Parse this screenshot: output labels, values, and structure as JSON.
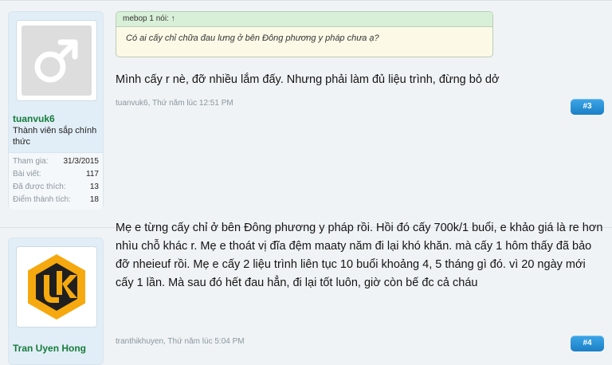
{
  "post3": {
    "user": {
      "name": "tuanvuk6",
      "title": "Thành viên sắp chính thức",
      "avatar_icon": "male-symbol-icon",
      "stats": [
        {
          "label": "Tham gia:",
          "value": "31/3/2015"
        },
        {
          "label": "Bài viết:",
          "value": "117"
        },
        {
          "label": "Đã được thích:",
          "value": "13"
        },
        {
          "label": "Điểm thành tích:",
          "value": "18"
        }
      ]
    },
    "quote": {
      "header": "mebop 1 nói: ↑",
      "text": "Có ai cấy chỉ chữa đau lưng ở bên Đông phương y pháp chưa ạ?"
    },
    "message": "Mình cấy r nè, đỡ nhiều lắm đấy. Nhưng phải làm đủ liệu trình, đừng bỏ dở",
    "meta": "tuanvuk6, Thứ năm lúc 12:51 PM",
    "number": "#3"
  },
  "post4": {
    "user": {
      "name": "Tran Uyen Hong",
      "avatar_icon": "uk-hexagon-logo-icon"
    },
    "message": "Mẹ e từng cấy chỉ ở bên Đông phương y pháp rồi. Hồi đó cấy 700k/1 buổi, e khảo giá là re hơn nhìu chỗ khác r. Mẹ e thoát vị đĩa đệm maaty năm đi lại khó khăn. mà cấy 1 hôm thấy đã bảo đỡ nheieuf rồi. Mẹ e cấy 2 liệu trình liên tục 10 buổi khoảng 4, 5 tháng gì đó. vì 20 ngày mới cấy 1 lần. Mà sau đó hết đau hẳn, đi lại tốt luôn, giờ còn bế đc cả cháu",
    "meta": "tranthikhuyen, Thứ năm lúc 5:04 PM",
    "number": "#4"
  },
  "colors": {
    "username": "#157c3c",
    "button": "#2a92d8",
    "panel": "#e2eef7",
    "quote_header": "#d9f0d8",
    "quote_body": "#fcf9e6"
  }
}
